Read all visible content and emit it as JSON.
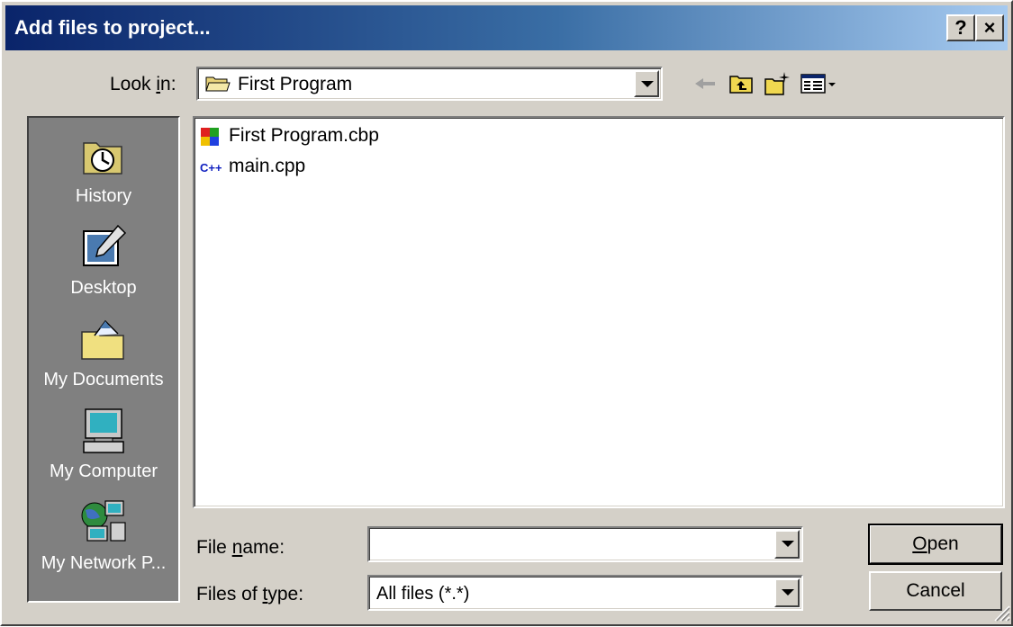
{
  "window": {
    "title": "Add files to project...",
    "help_button": "?",
    "close_button": "×"
  },
  "look_in": {
    "label_pre": "Look ",
    "label_mnemonic": "i",
    "label_post": "n:",
    "value": "First Program",
    "icon": "folder-open-icon"
  },
  "toolbar": {
    "icons": [
      "back-arrow-icon",
      "up-one-level-icon",
      "new-folder-icon",
      "view-menu-icon"
    ]
  },
  "places": [
    {
      "label": "History",
      "icon": "history-icon"
    },
    {
      "label": "Desktop",
      "icon": "desktop-icon"
    },
    {
      "label": "My Documents",
      "icon": "my-documents-icon"
    },
    {
      "label": "My Computer",
      "icon": "my-computer-icon"
    },
    {
      "label": "My Network P...",
      "icon": "my-network-places-icon"
    }
  ],
  "files": [
    {
      "name": "First Program.cbp",
      "icon": "codeblocks-project-icon"
    },
    {
      "name": "main.cpp",
      "icon": "cpp-file-icon"
    }
  ],
  "file_name": {
    "label_pre": "File ",
    "label_mnemonic": "n",
    "label_post": "ame:",
    "value": ""
  },
  "file_type": {
    "label_pre": "Files of ",
    "label_mnemonic": "t",
    "label_post": "ype:",
    "value": "All files (*.*)"
  },
  "buttons": {
    "open_mnemonic": "O",
    "open_rest": "pen",
    "cancel": "Cancel"
  },
  "colors": {
    "title_start": "#0a246a",
    "title_end": "#a6caf0",
    "face": "#d4d0c8",
    "places_bg": "#808080"
  }
}
